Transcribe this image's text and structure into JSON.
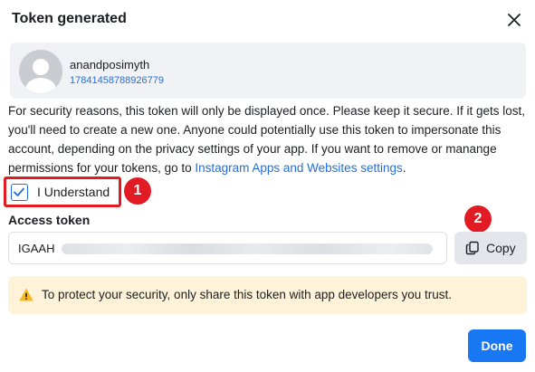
{
  "dialog": {
    "title": "Token generated",
    "close_icon": "close-icon"
  },
  "account": {
    "name": "anandposimyth",
    "id": "17841458788926779",
    "avatar_icon": "default-avatar-icon"
  },
  "notice": {
    "text": "For security reasons, this token will only be displayed once. Please keep it secure. If it gets lost, you'll need to create a new one. Anyone could potentially use this token to impersonate this account, depending on the privacy settings of your app. If you want to remove or manange permissions for your tokens, go to ",
    "link": "Instagram Apps and Websites settings",
    "suffix": "."
  },
  "understand": {
    "label": "I Understand",
    "checked": true
  },
  "steps": {
    "one": "1",
    "two": "2"
  },
  "token": {
    "label": "Access token",
    "value_visible": "IGAAH"
  },
  "copy_button": {
    "label": "Copy",
    "icon": "copy-icon"
  },
  "warning": {
    "icon": "warning-icon",
    "text": "To protect your security, only share this token with app developers you trust."
  },
  "done_button": {
    "label": "Done"
  },
  "colors": {
    "accent": "#1877f2",
    "link": "#216fdb",
    "annotation_red": "#e01b24",
    "warning_bg": "#fef3d8",
    "warning_icon": "#f7b928"
  }
}
